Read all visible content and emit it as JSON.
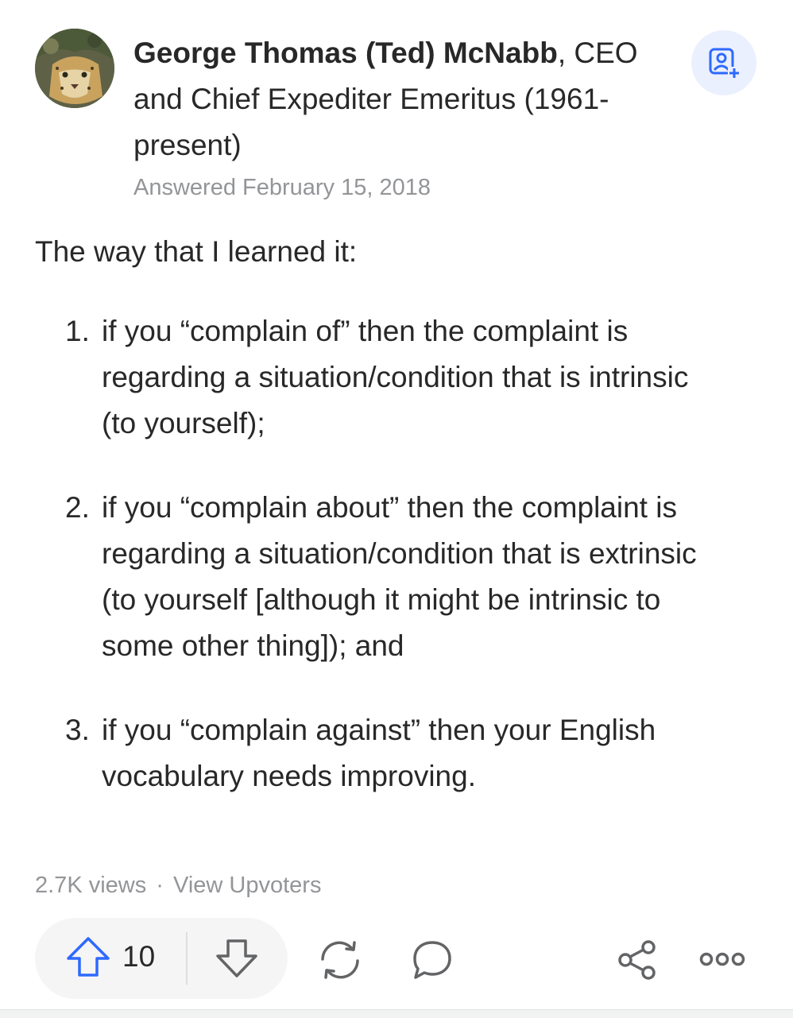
{
  "author": {
    "name": "George Thomas (Ted) McNabb",
    "credential": ", CEO and Chief Expediter Emeritus (1961-present)",
    "avatar": "avatar-image"
  },
  "answered": "Answered February 15, 2018",
  "answer": {
    "intro": "The way that I learned it:",
    "items": [
      {
        "number": "1.",
        "text": "if you “complain of” then the complaint is regarding a situation/condition that is intrinsic (to yourself);"
      },
      {
        "number": "2.",
        "text": "if you “complain about” then the complaint is regarding a situation/condition that is extrinsic (to yourself [although it might be intrinsic to some other thing]); and"
      },
      {
        "number": "3.",
        "text": "if you “complain against” then your English vocabulary needs improving."
      }
    ]
  },
  "stats": {
    "views": "2.7K views",
    "separator": "·",
    "upvoters_link": "View Upvoters"
  },
  "actions": {
    "upvote_count": "10",
    "icons": [
      "follow-user-icon",
      "upvote-icon",
      "downvote-icon",
      "share-reshare-icon",
      "comment-icon",
      "share-icon",
      "more-icon"
    ]
  },
  "colors": {
    "accent": "#2e69ff",
    "text": "#282829",
    "muted": "#939598",
    "pill_bg": "#f5f5f5",
    "follow_bg": "#ebf0ff"
  }
}
